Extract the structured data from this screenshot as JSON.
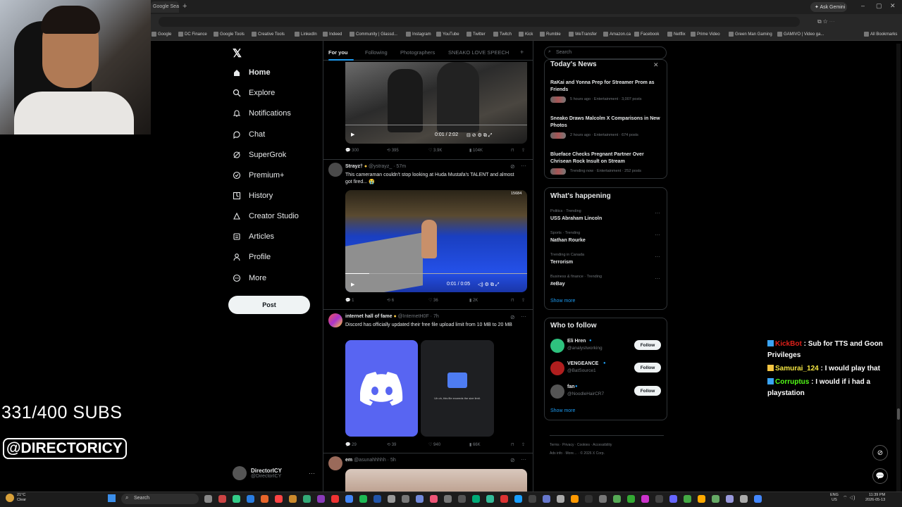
{
  "browser": {
    "tab_title": "Google Sea",
    "gemini_label": "Ask Gemini",
    "bookmarks": [
      "Google",
      "DC Finance",
      "Google Tools",
      "Creative Tools",
      "LinkedIn",
      "Indeed",
      "Community | Glassd...",
      "Instagram",
      "YouTube",
      "Twitter",
      "Twitch",
      "Kick",
      "Rumble",
      "WeTransfer",
      "Amazon.ca",
      "Facebook",
      "Netflix",
      "Prime Video",
      "Green Man Gaming",
      "GAMIVO | Video ga..."
    ],
    "all_bookmarks": "All Bookmarks"
  },
  "overlay": {
    "subs": "331/400 SUBS",
    "handle": "@DIRECTORICY"
  },
  "nav": {
    "items": [
      {
        "label": "Home",
        "icon": "home-icon"
      },
      {
        "label": "Explore",
        "icon": "search-icon"
      },
      {
        "label": "Notifications",
        "icon": "bell-icon"
      },
      {
        "label": "Chat",
        "icon": "chat-icon"
      },
      {
        "label": "SuperGrok",
        "icon": "grok-icon"
      },
      {
        "label": "Premium+",
        "icon": "verified-icon"
      },
      {
        "label": "History",
        "icon": "history-icon"
      },
      {
        "label": "Creator Studio",
        "icon": "creator-studio-icon"
      },
      {
        "label": "Articles",
        "icon": "articles-icon"
      },
      {
        "label": "Profile",
        "icon": "profile-icon"
      },
      {
        "label": "More",
        "icon": "more-icon"
      }
    ],
    "post_label": "Post",
    "account_name": "DirectorICY",
    "account_handle": "@DirectorICY"
  },
  "feed": {
    "tabs": [
      "For you",
      "Following",
      "Photographers",
      "SNEAKO LOVE SPEECH"
    ],
    "post1": {
      "time": "0:01 / 2:02",
      "replies": "300",
      "reposts": "395",
      "likes": "3.9K",
      "views": "104K"
    },
    "post2": {
      "name": "Strayz†",
      "handle": "@ystrayz_ · 57m",
      "text": "This cameraman couldn't stop looking at Huda Mustafa's TALENT and almost got fired... 😭",
      "view_count": "15684",
      "time": "0:01 / 0:05",
      "replies": "1",
      "reposts": "6",
      "likes": "36",
      "views": "2K"
    },
    "post3": {
      "name": "internet hall of fame",
      "handle": "@InternetH0F · 7h",
      "text": "Discord has officially updated their free file upload limit from 10 MB to 20 MB",
      "image_caption": "Uh oh, this file exceeds the size limit.",
      "replies": "29",
      "reposts": "39",
      "likes": "940",
      "views": "66K"
    },
    "post4": {
      "name": "em",
      "handle": "@asunahhhhh · 5h"
    }
  },
  "right": {
    "search_placeholder": "Search",
    "news_title": "Today's News",
    "news": [
      {
        "headline": "RaKai and Yonna Prep for Streamer Prom as Friends",
        "meta": "5 hours ago · Entertainment · 3,007 posts"
      },
      {
        "headline": "Sneako Draws Malcolm X Comparisons in New Photos",
        "meta": "2 hours ago · Entertainment · 674 posts"
      },
      {
        "headline": "Blueface Checks Pregnant Partner Over Chrisean Rock Insult on Stream",
        "meta": "Trending now · Entertainment · 252 posts"
      }
    ],
    "happening_title": "What's happening",
    "trends": [
      {
        "meta": "Politics · Trending",
        "name": "USS Abraham Lincoln"
      },
      {
        "meta": "Sports · Trending",
        "name": "Nathan Rourke"
      },
      {
        "meta": "Trending in Canada",
        "name": "Terrorism"
      },
      {
        "meta": "Business & finance · Trending",
        "name": "#eBay"
      }
    ],
    "show_more": "Show more",
    "follow_title": "Who to follow",
    "follow": [
      {
        "name": "Eli Hren",
        "handle": "@analystworking",
        "button": "Follow"
      },
      {
        "name": "VENGEANCE",
        "handle": "@BatSource1",
        "button": "Follow"
      },
      {
        "name": "fan",
        "handle": "@NoodleHairCR7",
        "button": "Follow"
      }
    ],
    "footer_line1": "Terms · Privacy · Cookies · Accessibility",
    "footer_line2": "Ads info · More… · © 2026 X Corp."
  },
  "chat": [
    {
      "user": "KickBot",
      "msg": "Sub for TTS and Goon Privileges",
      "color": "#e0201a"
    },
    {
      "user": "Samurai_124",
      "msg": "I would play that",
      "color": "#f5e642"
    },
    {
      "user": "Corruptus",
      "msg": "I would if i had a playstation",
      "color": "#53fc18"
    }
  ],
  "taskbar": {
    "search": "Search",
    "weather_temp": "21°C",
    "weather_desc": "Clear",
    "lang1": "ENG",
    "lang2": "US",
    "time": "11:39 PM",
    "date": "2026-05-13"
  }
}
